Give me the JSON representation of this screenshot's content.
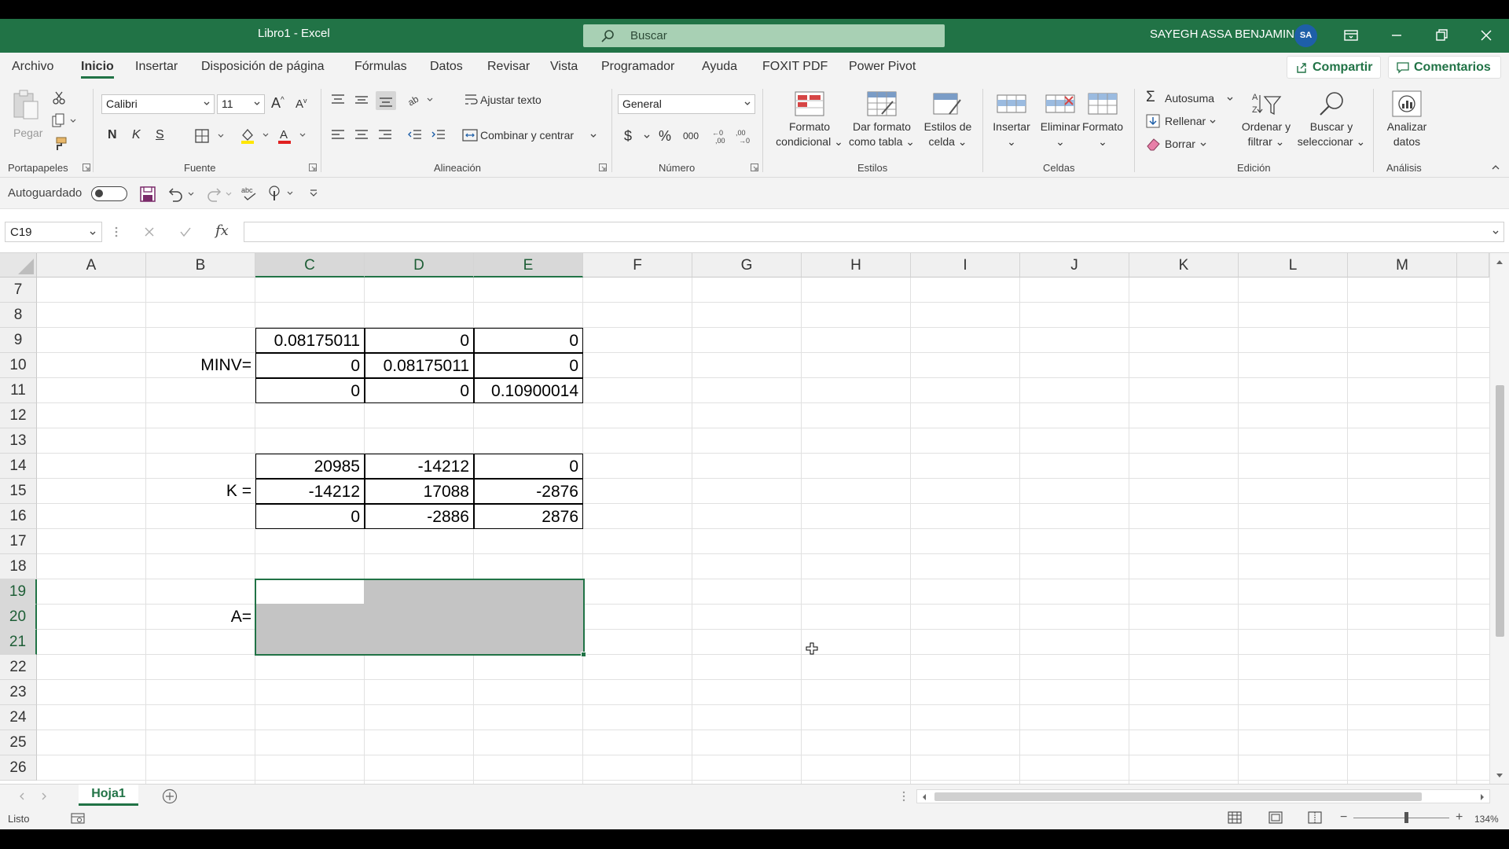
{
  "window": {
    "title": "Libro1  -  Excel",
    "search_placeholder": "Buscar",
    "user_name": "SAYEGH ASSA BENJAMIN",
    "user_initials": "SA"
  },
  "tabs": [
    "Archivo",
    "Inicio",
    "Insertar",
    "Disposición de página",
    "Fórmulas",
    "Datos",
    "Revisar",
    "Vista",
    "Programador",
    "Ayuda",
    "FOXIT PDF",
    "Power Pivot"
  ],
  "active_tab": "Inicio",
  "actions": {
    "share": "Compartir",
    "comments": "Comentarios"
  },
  "ribbon": {
    "clipboard": {
      "label": "Portapapeles",
      "paste": "Pegar"
    },
    "font": {
      "label": "Fuente",
      "name": "Calibri",
      "size": "11",
      "bold": "N",
      "italic": "K",
      "underline": "S"
    },
    "alignment": {
      "label": "Alineación",
      "wrap": "Ajustar texto",
      "merge": "Combinar y centrar"
    },
    "number": {
      "label": "Número",
      "format": "General"
    },
    "styles": {
      "label": "Estilos",
      "conditional": [
        "Formato",
        "condicional"
      ],
      "as_table": [
        "Dar formato",
        "como tabla"
      ],
      "cell_styles": [
        "Estilos de",
        "celda"
      ]
    },
    "cells": {
      "label": "Celdas",
      "insert": "Insertar",
      "delete": "Eliminar",
      "format": "Formato"
    },
    "editing": {
      "label": "Edición",
      "autosum": "Autosuma",
      "fill": "Rellenar",
      "clear": "Borrar",
      "sort": [
        "Ordenar y",
        "filtrar"
      ],
      "find": [
        "Buscar y",
        "seleccionar"
      ]
    },
    "analysis": {
      "label": "Análisis",
      "analyze": [
        "Analizar",
        "datos"
      ]
    }
  },
  "qat": {
    "autosave": "Autoguardado"
  },
  "formula_bar": {
    "name_box": "C19",
    "fx": "fx",
    "content": ""
  },
  "sheet": {
    "columns": [
      "A",
      "B",
      "C",
      "D",
      "E",
      "F",
      "G",
      "H",
      "I",
      "J",
      "K",
      "L",
      "M"
    ],
    "rows": [
      "7",
      "8",
      "9",
      "10",
      "11",
      "12",
      "13",
      "14",
      "15",
      "16",
      "17",
      "18",
      "19",
      "20",
      "21",
      "22",
      "23",
      "24",
      "25",
      "26"
    ],
    "labels": {
      "minv": "MINV=",
      "k": "K =",
      "a": "A="
    },
    "minv": [
      [
        "0.08175011",
        "0",
        "0"
      ],
      [
        "0",
        "0.08175011",
        "0"
      ],
      [
        "0",
        "0",
        "0.10900014"
      ]
    ],
    "k": [
      [
        "20985",
        "-14212",
        "0"
      ],
      [
        "-14212",
        "17088",
        "-2876"
      ],
      [
        "0",
        "-2886",
        "2876"
      ]
    ]
  },
  "sheet_tabs": [
    "Hoja1"
  ],
  "status": {
    "text": "Listo",
    "zoom": "134%"
  },
  "colors": {
    "accent": "#217346",
    "selection": "#c4c4c4"
  }
}
